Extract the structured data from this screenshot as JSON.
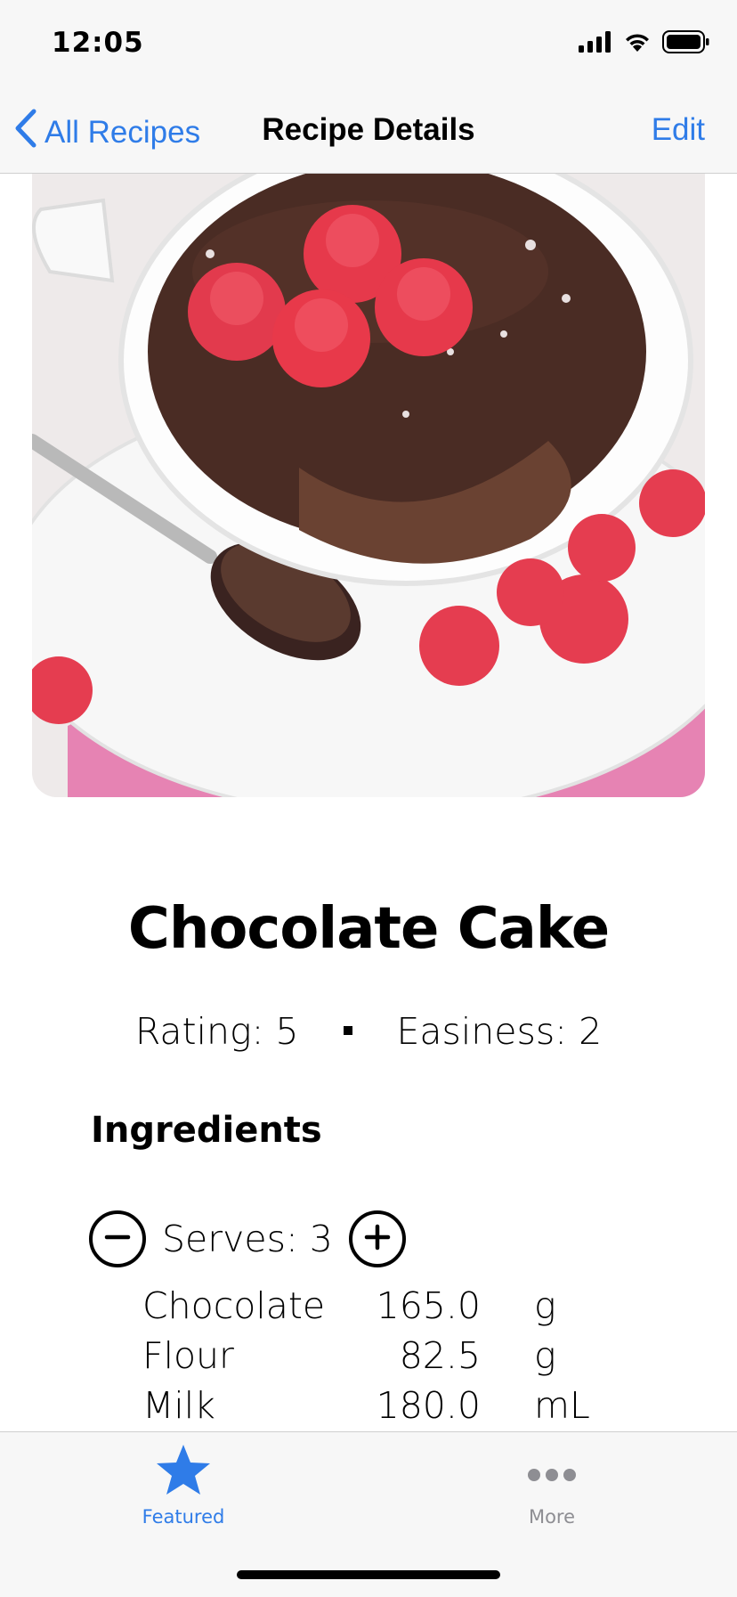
{
  "status_bar": {
    "time": "12:05",
    "icons": [
      "cellular-signal-icon",
      "wifi-icon",
      "battery-icon"
    ]
  },
  "nav": {
    "back_label": "All Recipes",
    "title": "Recipe Details",
    "edit_label": "Edit"
  },
  "recipe": {
    "image_description_icon": "chocolate-mug-cake-photo",
    "title": "Chocolate Cake",
    "rating_text": "Rating: 5",
    "easiness_text": "Easiness: 2",
    "ingredients_heading": "Ingredients",
    "serves_text": "Serves: 3",
    "ingredients": [
      {
        "name": "Chocolate",
        "amount": "165.0",
        "unit": "g"
      },
      {
        "name": "Flour",
        "amount": "82.5",
        "unit": "g"
      },
      {
        "name": "Milk",
        "amount": "180.0",
        "unit": "mL"
      }
    ]
  },
  "tab_bar": {
    "tabs": [
      {
        "label": "Featured",
        "icon": "star-icon",
        "selected": true
      },
      {
        "label": "More",
        "icon": "more-dots-icon",
        "selected": false
      }
    ]
  },
  "colors": {
    "accent": "#2f7ce8",
    "tab_inactive": "#8e8e93",
    "bar_background": "#f7f7f7"
  }
}
